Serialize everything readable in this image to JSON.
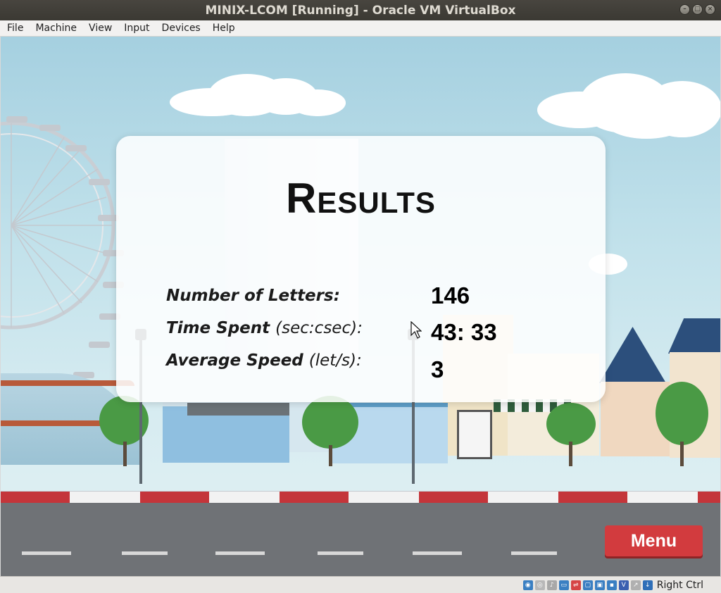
{
  "window": {
    "title": "MINIX-LCOM [Running] - Oracle VM VirtualBox"
  },
  "menubar": {
    "items": [
      "File",
      "Machine",
      "View",
      "Input",
      "Devices",
      "Help"
    ]
  },
  "results": {
    "title": "Results",
    "rows": [
      {
        "label": "Number of Letters:",
        "value": "146"
      },
      {
        "label": "Time Spent",
        "label_suffix": "(sec:csec):",
        "value": "43: 33"
      },
      {
        "label": "Average Speed",
        "label_suffix": "(let/s):",
        "value": "3"
      }
    ]
  },
  "menu_button": {
    "label": "Menu"
  },
  "statusbar": {
    "host_key": "Right Ctrl",
    "icons": [
      "hard-disk-icon",
      "optical-drive-icon",
      "audio-icon",
      "network-icon",
      "usb-icon",
      "shared-folder-icon",
      "display-icon",
      "video-capture-icon",
      "virtualization-icon",
      "mouse-integration-icon",
      "keyboard-capture-icon"
    ]
  },
  "colors": {
    "accent_red": "#d23b3e",
    "panel_bg": "#ffffff",
    "titlebar_bg": "#3b3933"
  }
}
